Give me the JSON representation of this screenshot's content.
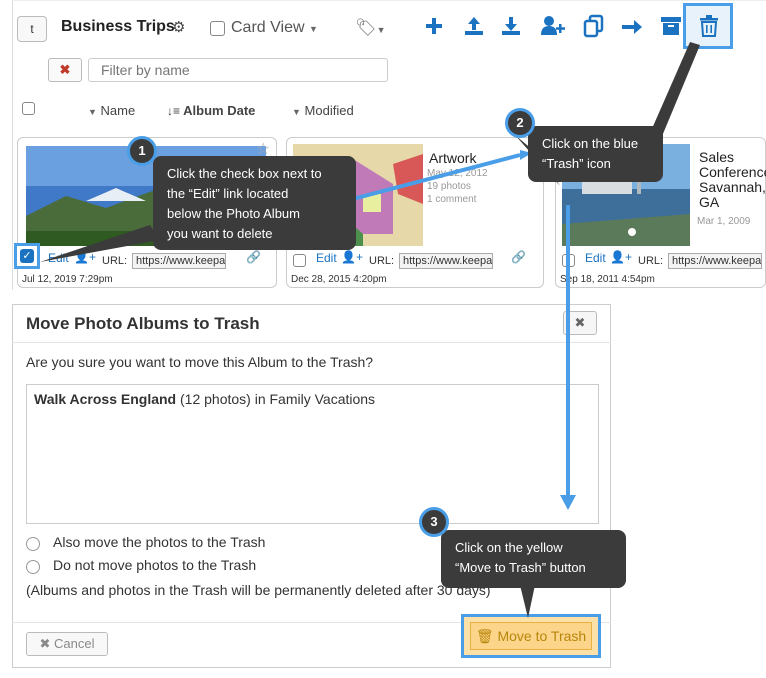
{
  "toolbar": {
    "back_label": "t",
    "album_title": "Business Trips",
    "card_view_label": "Card View",
    "add_icon": "plus-icon",
    "upload_icon": "upload-icon",
    "download_icon": "download-icon",
    "add_user_icon": "add-user-icon",
    "copy_icon": "copy-icon",
    "move_icon": "arrow-right-icon",
    "archive_icon": "archive-icon",
    "trash_icon": "trash-icon"
  },
  "filter": {
    "clear_label": "✖",
    "placeholder": "Filter by name"
  },
  "sort": {
    "name": "Name",
    "album_date": "Album Date",
    "modified": "Modified"
  },
  "cards": [
    {
      "edit": "Edit",
      "url_label": "URL:",
      "url": "https://www.keepa",
      "date": "Jul 12, 2019 7:29pm",
      "checked": true
    },
    {
      "title": "Artwork",
      "album_date": "May 12, 2012",
      "photos": "19 photos",
      "comments": "1 comment",
      "edit": "Edit",
      "url_label": "URL:",
      "url": "https://www.keepa",
      "date": "Dec 28, 2015 4:20pm"
    },
    {
      "title_lines": [
        "Sales",
        "Conference",
        "Savannah,",
        "GA"
      ],
      "album_date": "Mar 1, 2009",
      "edit": "Edit",
      "url_label": "URL:",
      "url": "https://www.keepa",
      "date": "Sep 18, 2011 4:54pm"
    }
  ],
  "callouts": [
    {
      "num": "1",
      "lines": [
        "Click the check box next to",
        "the “Edit” link located",
        "below the Photo Album",
        "you want to delete"
      ]
    },
    {
      "num": "2",
      "lines": [
        "Click on the blue",
        "“Trash” icon"
      ]
    },
    {
      "num": "3",
      "lines": [
        "Click on the yellow",
        "“Move to Trash” button"
      ]
    }
  ],
  "modal": {
    "title": "Move Photo Albums to Trash",
    "close": "✖",
    "question": "Are you sure you want to move this Album to the Trash?",
    "album_name": "Walk Across England",
    "album_detail": " (12 photos) in Family Vacations",
    "option_move": "Also move the photos to the Trash",
    "option_keep": "Do not move photos to the Trash",
    "note": "(Albums and photos in the Trash will be permanently deleted after 30 days)",
    "cancel": "✖ Cancel",
    "confirm": "Move to Trash"
  },
  "colors": {
    "accent": "#1a72c0",
    "highlight": "#4a9ee8",
    "callout_bg": "#3b3b3b",
    "confirm_bg": "#fcd58a"
  }
}
